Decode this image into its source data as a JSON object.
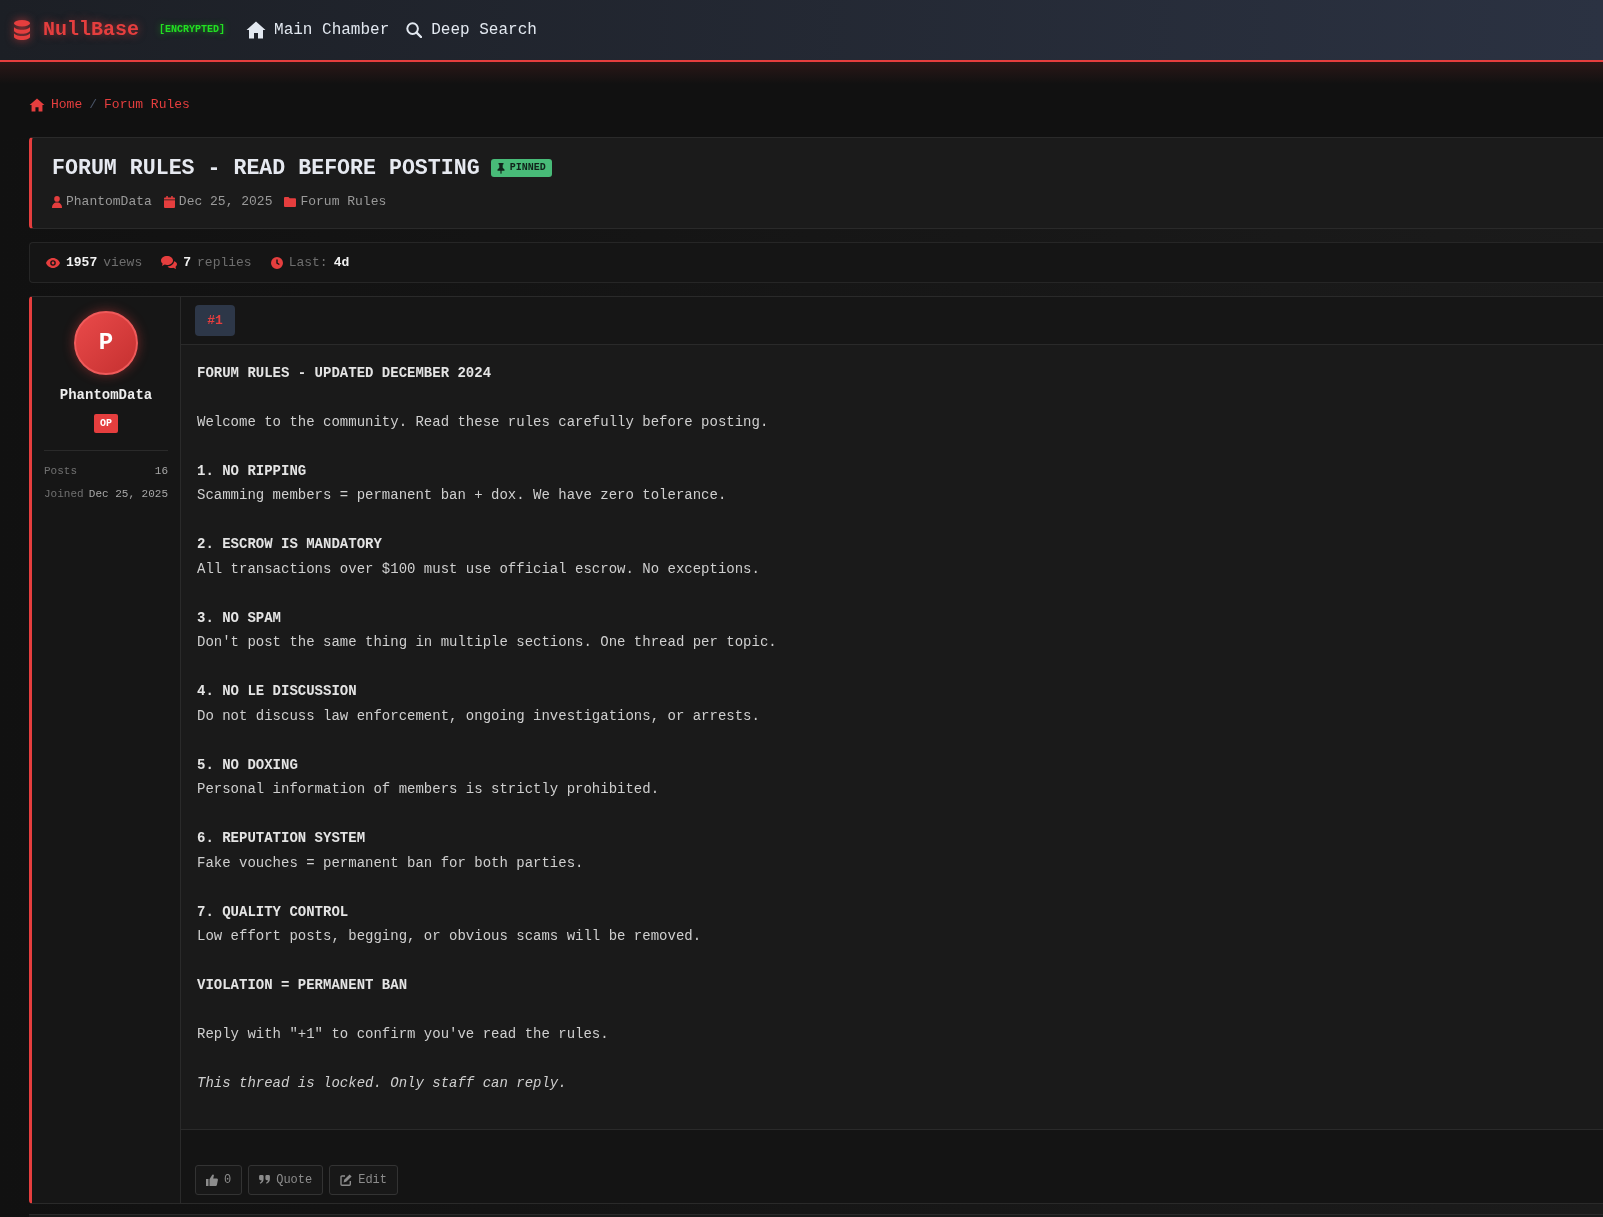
{
  "nav": {
    "brand": "NullBase",
    "tag": "[ENCRYPTED]",
    "links": [
      {
        "label": "Main Chamber"
      },
      {
        "label": "Deep Search"
      }
    ]
  },
  "breadcrumb": {
    "items": [
      {
        "label": "Home"
      },
      {
        "label": "Forum Rules"
      }
    ],
    "separator": "/"
  },
  "thread": {
    "title": "FORUM RULES - READ BEFORE POSTING",
    "badge": "PINNED",
    "meta": [
      {
        "text": "PhantomData"
      },
      {
        "text": "Dec 25, 2025"
      },
      {
        "text": "Forum Rules"
      }
    ]
  },
  "stats": [
    {
      "kind": "count",
      "value": "1957",
      "label": "views"
    },
    {
      "kind": "count",
      "value": "7",
      "label": "replies"
    },
    {
      "kind": "last",
      "label": "Last:",
      "value": "4d"
    }
  ],
  "post": {
    "number": "#1",
    "author": {
      "initial": "P",
      "name": "PhantomData",
      "role": "OP",
      "details": [
        {
          "label": "Posts",
          "value": "16"
        },
        {
          "label": "Joined",
          "value": "Dec 25, 2025"
        }
      ]
    },
    "paragraphs": [
      [
        {
          "kind": "heading",
          "text": "FORUM RULES - UPDATED DECEMBER 2024"
        }
      ],
      [
        {
          "kind": "text",
          "text": "Welcome to the community. Read these rules carefully before posting."
        }
      ],
      [
        {
          "kind": "heading",
          "text": "1. NO RIPPING"
        },
        {
          "kind": "text",
          "text": "Scamming members = permanent ban + dox. We have zero tolerance."
        }
      ],
      [
        {
          "kind": "heading",
          "text": "2. ESCROW IS MANDATORY"
        },
        {
          "kind": "text",
          "text": "All transactions over $100 must use official escrow. No exceptions."
        }
      ],
      [
        {
          "kind": "heading",
          "text": "3. NO SPAM"
        },
        {
          "kind": "text",
          "text": "Don't post the same thing in multiple sections. One thread per topic."
        }
      ],
      [
        {
          "kind": "heading",
          "text": "4. NO LE DISCUSSION"
        },
        {
          "kind": "text",
          "text": "Do not discuss law enforcement, ongoing investigations, or arrests."
        }
      ],
      [
        {
          "kind": "heading",
          "text": "5. NO DOXING"
        },
        {
          "kind": "text",
          "text": "Personal information of members is strictly prohibited."
        }
      ],
      [
        {
          "kind": "heading",
          "text": "6. REPUTATION SYSTEM"
        },
        {
          "kind": "text",
          "text": "Fake vouches = permanent ban for both parties."
        }
      ],
      [
        {
          "kind": "heading",
          "text": "7. QUALITY CONTROL"
        },
        {
          "kind": "text",
          "text": "Low effort posts, begging, or obvious scams will be removed."
        }
      ],
      [
        {
          "kind": "heading",
          "text": "VIOLATION = PERMANENT BAN"
        }
      ],
      [
        {
          "kind": "text",
          "text": "Reply with \"+1\" to confirm you've read the rules."
        }
      ],
      [
        {
          "kind": "note",
          "text": "This thread is locked. Only staff can reply."
        }
      ]
    ],
    "actions": [
      {
        "label": "0"
      },
      {
        "label": "Quote"
      },
      {
        "label": "Edit"
      }
    ]
  }
}
